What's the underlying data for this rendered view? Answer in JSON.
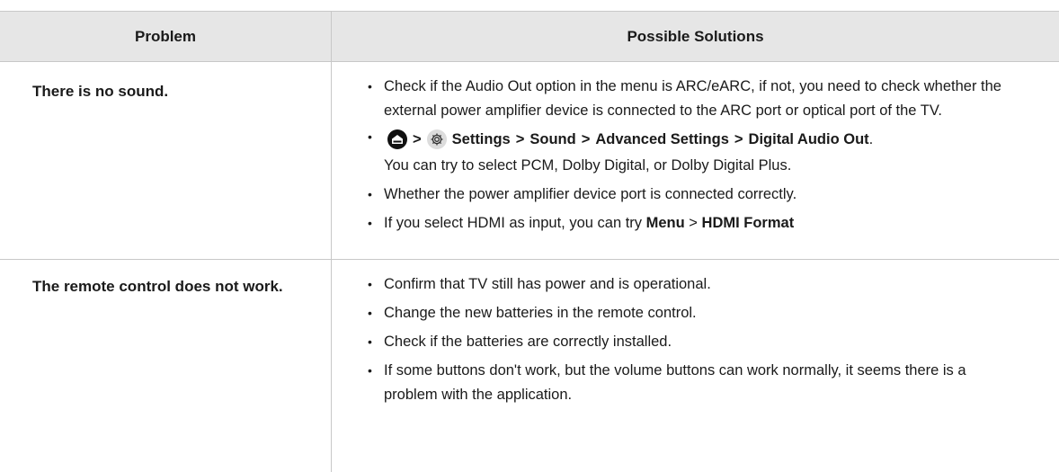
{
  "table": {
    "headers": {
      "problem": "Problem",
      "solutions": "Possible Solutions"
    },
    "rows": [
      {
        "problem": "There is no sound.",
        "solutions": {
          "b1": "Check if the Audio Out option in the menu is ARC/eARC, if not, you need to check whether the external power amplifier device is connected to the ARC port or optical port of the TV.",
          "path": {
            "sep": ">",
            "settings": "Settings",
            "sound": "Sound",
            "advanced": "Advanced Settings",
            "digital_audio_out": "Digital Audio Out",
            "end": "."
          },
          "b2_tail": "You can try to select PCM, Dolby Digital, or Dolby Digital Plus.",
          "b3": "Whether the power amplifier device port is connected correctly.",
          "b4_text": "If you select HDMI as input, you can try ",
          "b4_menu": "Menu",
          "b4_sep": " > ",
          "b4_format": "HDMI Format"
        }
      },
      {
        "problem": "The remote control does not work.",
        "solutions": {
          "b1": "Confirm that TV still has power and is operational.",
          "b2": "Change the new batteries in the remote control.",
          "b3": "Check if the batteries are correctly installed.",
          "b4": "If some buttons don't work, but the volume buttons can work normally, it seems there is a problem with the application."
        }
      }
    ]
  },
  "icons": {
    "home": "home-icon",
    "settings": "gear-icon"
  }
}
